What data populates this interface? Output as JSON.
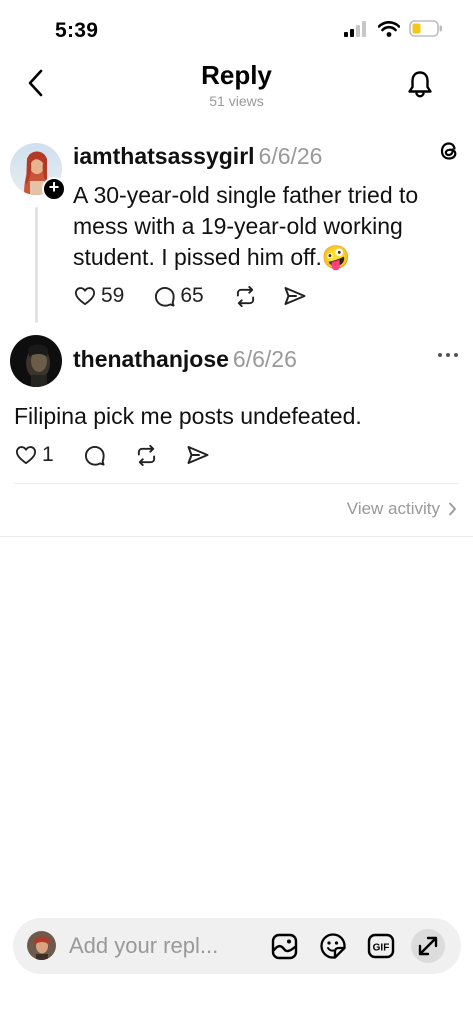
{
  "status_bar": {
    "time": "5:39",
    "icons": [
      "cellular-signal-icon",
      "wifi-icon",
      "battery-low-icon"
    ],
    "battery_color": "#f5c518"
  },
  "header": {
    "title": "Reply",
    "views": "51 views",
    "icons": [
      "back-chevron-icon",
      "bell-icon"
    ]
  },
  "original_post": {
    "username": "iamthatsassygirl",
    "date": "6/6/26",
    "text_lines": [
      "A 30-year-old single father tried to",
      "mess with a 19-year-old working",
      "student. I  pissed him off."
    ],
    "emoji": "🤪",
    "likes": "59",
    "replies": "65",
    "icons": [
      "threads-logo-icon",
      "heart-icon",
      "comment-icon",
      "repost-icon",
      "share-icon",
      "follow-plus-icon"
    ]
  },
  "reply_post": {
    "username": "thenathanjose",
    "date": "6/6/26",
    "text": "Filipina pick me posts undefeated.",
    "likes": "1",
    "icons": [
      "more-options-icon",
      "heart-icon",
      "comment-icon",
      "repost-icon",
      "share-icon"
    ]
  },
  "view_activity": {
    "label": "View activity"
  },
  "composer": {
    "placeholder": "Add your repl...",
    "icons": [
      "image-gallery-icon",
      "sticker-icon",
      "gif-icon",
      "expand-icon"
    ]
  },
  "colors": {
    "text": "#111111",
    "muted": "#999999",
    "divider": "#ececec",
    "composer_bg": "#f0f0f0"
  }
}
